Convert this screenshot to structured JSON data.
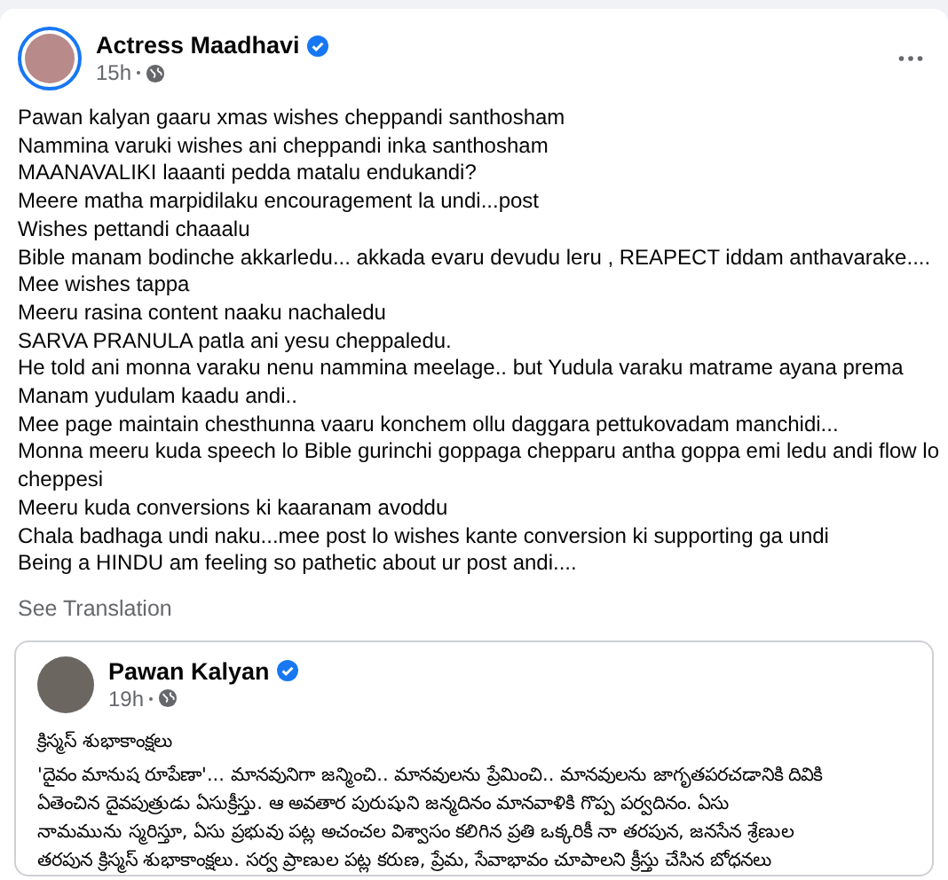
{
  "post": {
    "author": "Actress Maadhavi",
    "verified": true,
    "time": "15h",
    "lines": [
      "Pawan kalyan gaaru xmas wishes cheppandi santhosham",
      "Nammina varuki wishes ani cheppandi inka santhosham",
      "MAANAVALIKI laaanti pedda matalu endukandi?",
      "Meere matha marpidilaku encouragement la undi...post",
      "Wishes pettandi chaaalu",
      "Bible manam bodinche akkarledu... akkada evaru devudu leru , REAPECT iddam anthavarake....",
      "Mee wishes tappa",
      "Meeru rasina content naaku nachaledu",
      "SARVA PRANULA patla ani yesu cheppaledu.",
      "He told  ani monna varaku nenu nammina meelage.. but Yudula varaku matrame ayana prema",
      "Manam yudulam kaadu andi..",
      "Mee page maintain chesthunna vaaru konchem ollu daggara pettukovadam manchidi...",
      "Monna meeru kuda speech lo Bible gurinchi goppaga chepparu antha goppa emi ledu andi flow lo cheppesi",
      "Meeru kuda conversions ki kaaranam avoddu",
      "Chala badhaga undi naku...mee post lo wishes kante conversion ki supporting ga undi",
      "Being a HINDU am feeling so pathetic about ur post andi...."
    ],
    "see_translation": "See Translation",
    "shared_post": {
      "author": "Pawan Kalyan",
      "verified": true,
      "time": "19h",
      "title": "క్రిస్మస్ శుభాకాంక్షలు",
      "body_lines": [
        "'దైవం మానుష రూపేణా'... మానవునిగా జన్మించి.. మానవులను ప్రేమించి.. మానవులను జాగృతపరచడానికి దివికి",
        "ఏతెంచిన దైవపుత్రుడు ఏసుక్రీస్తు. ఆ అవతార పురుషుని జన్మదినం మానవాళికి గొప్ప పర్వదినం. ఏసు",
        "నామమును స్మరిస్తూ, ఏసు ప్రభువు పట్ల అచంచల విశ్వాసం కలిగిన ప్రతి ఒక్కరికీ నా తరపున, జనసేన శ్రేణుల",
        "తరపున క్రిస్మస్ శుభాకాంక్షలు. సర్వ ప్రాణుల పట్ల కరుణ, ప్రేమ, సేవాభావం చూపాలని క్రీస్తు చేసిన బోధనలు"
      ]
    }
  }
}
